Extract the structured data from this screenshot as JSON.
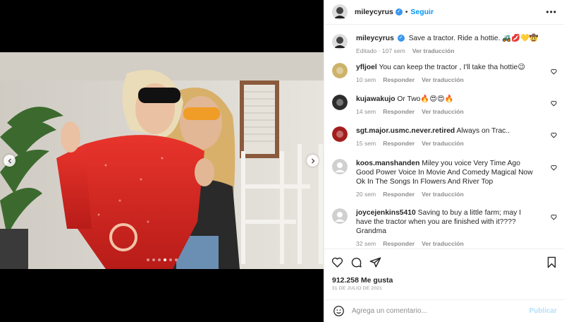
{
  "post": {
    "username": "mileycyrus",
    "follow_label": "Seguir",
    "separator": "•",
    "more_label": "•••",
    "carousel": {
      "slides": 6,
      "active_index": 3
    }
  },
  "caption": {
    "username": "mileycyrus",
    "text": "Save a tractor. Ride a hottie. 🚜💋💛🤠",
    "edited": "Editado",
    "time": "107 sem",
    "translate": "Ver traducción"
  },
  "comments": [
    {
      "username": "yfljoel",
      "text": "You can keep the tractor , I'll take tha hottie😉",
      "time": "10 sem",
      "reply": "Responder",
      "translate": "Ver traducción"
    },
    {
      "username": "kujawakujo",
      "text": "Or Two🔥😍😍🔥",
      "time": "14 sem",
      "reply": "Responder",
      "translate": "Ver traducción"
    },
    {
      "username": "sgt.major.usmc.never.retired",
      "text": "Always on Trac..",
      "time": "15 sem",
      "reply": "Responder",
      "translate": "Ver traducción"
    },
    {
      "username": "koos.manshanden",
      "text": "Miley you voice Very Time Ago Good Power Voice In Movie And Comedy Magical Now Ok In The Songs In Flowers And River Top",
      "time": "20 sem",
      "reply": "Responder",
      "translate": "Ver traducción"
    },
    {
      "username": "joycejenkins5410",
      "text": "Saving to buy a little farm; may I have the tractor when you are finished with it???? Grandma",
      "time": "32 sem",
      "reply": "Responder",
      "translate": "Ver traducción"
    }
  ],
  "likes": "912.258 Me gusta",
  "date": "31 DE JULIO DE 2021",
  "add_comment": {
    "placeholder": "Agrega un comentario...",
    "publish": "Publicar"
  },
  "colors": {
    "accent": "#0095f6",
    "verified": "#3897f0",
    "muted": "#8e8e8e"
  }
}
